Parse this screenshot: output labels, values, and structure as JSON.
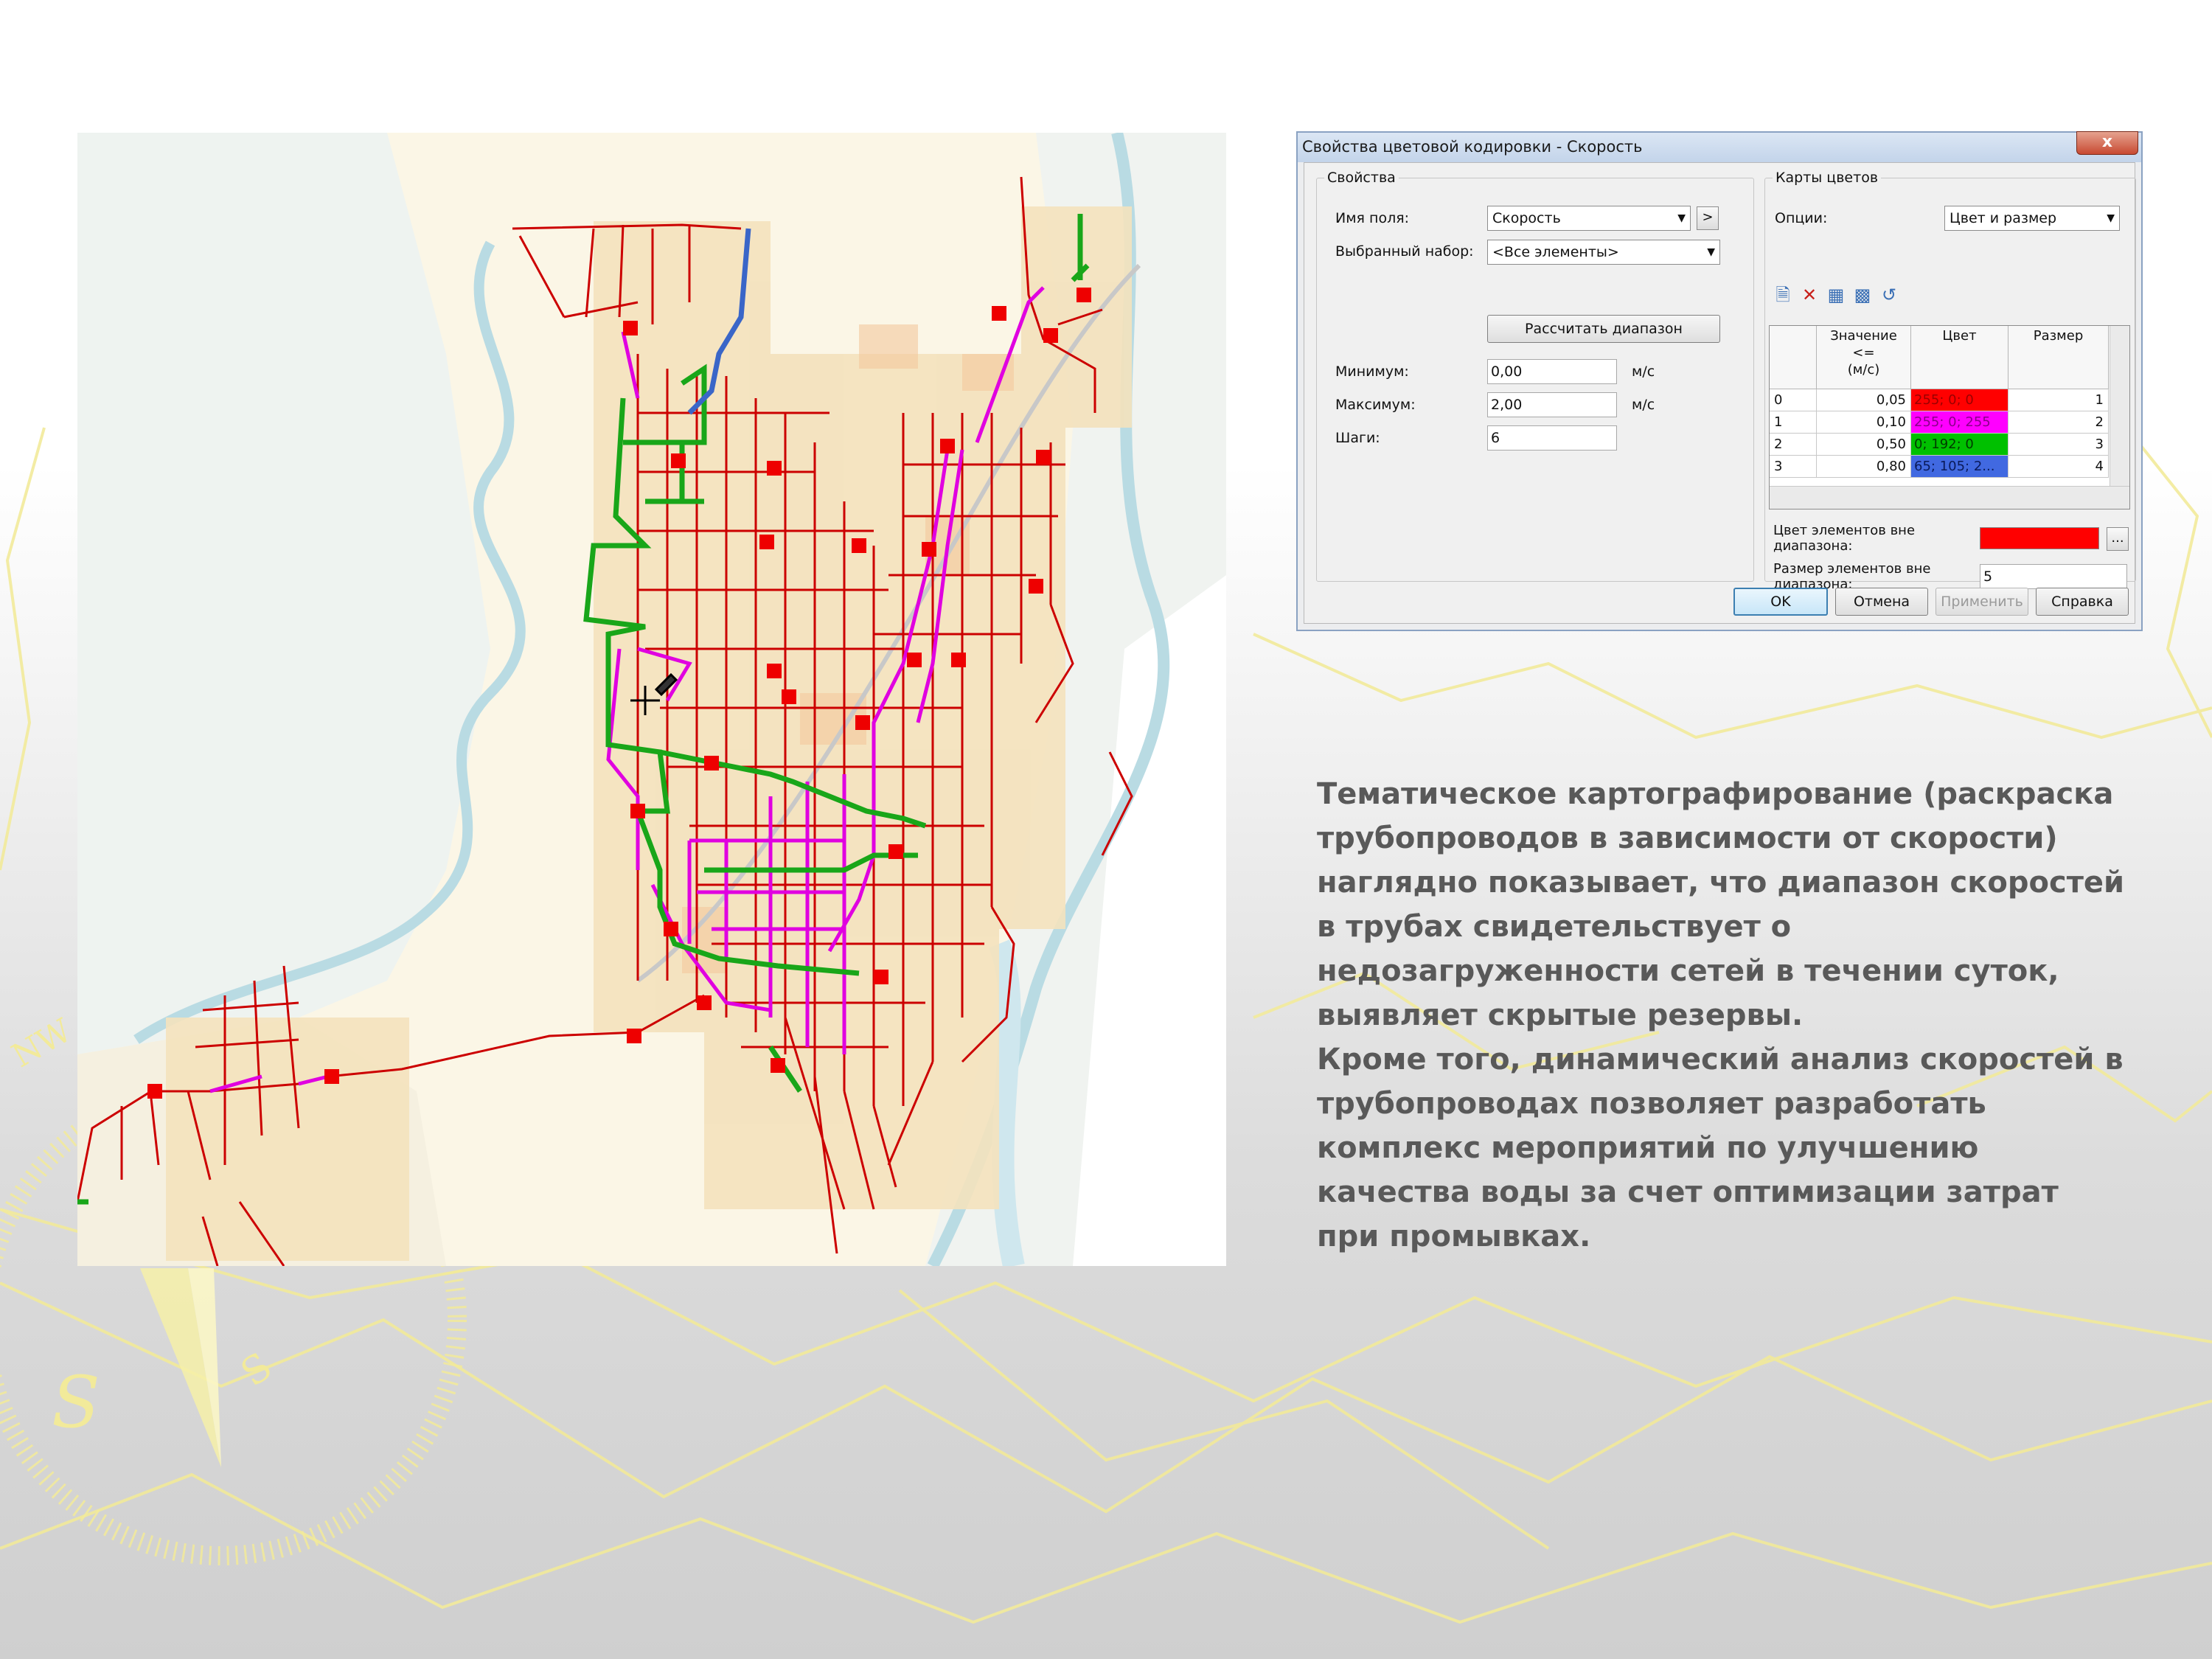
{
  "dialog": {
    "title": "Свойства цветовой кодировки - Скорость",
    "close_label": "x",
    "properties": {
      "group_label": "Свойства",
      "field_name_label": "Имя поля:",
      "field_name_value": "Скорость",
      "selection_label": "Выбранный набор:",
      "selection_value": "<Все элементы>",
      "calc_range_button": "Рассчитать диапазон",
      "minimum_label": "Минимум:",
      "minimum_value": "0,00",
      "minimum_unit": "м/с",
      "maximum_label": "Максимум:",
      "maximum_value": "2,00",
      "maximum_unit": "м/с",
      "steps_label": "Шаги:",
      "steps_value": "6"
    },
    "color_maps": {
      "group_label": "Карты цветов",
      "options_label": "Опции:",
      "options_value": "Цвет и размер",
      "columns": [
        "",
        "Значение\n<=\n(м/с)",
        "Цвет",
        "Размер"
      ],
      "rows": [
        {
          "index": "0",
          "value": "0,05",
          "color_text": "255; 0; 0",
          "color_hex": "#ff0000",
          "size": "1"
        },
        {
          "index": "1",
          "value": "0,10",
          "color_text": "255; 0; 255",
          "color_hex": "#ff00ff",
          "size": "2"
        },
        {
          "index": "2",
          "value": "0,50",
          "color_text": "0; 192; 0",
          "color_hex": "#00c000",
          "size": "3"
        },
        {
          "index": "3",
          "value": "0,80",
          "color_text": "65; 105; 2...",
          "color_hex": "#4169e1",
          "size": "4"
        }
      ],
      "out_of_range_color_label": "Цвет элементов вне диапазона:",
      "out_of_range_color_hex": "#ff0000",
      "out_of_range_size_label": "Размер элементов вне диапазона:",
      "out_of_range_size_value": "5",
      "ellipsis_button": "..."
    },
    "buttons": {
      "ok": "OK",
      "cancel": "Отмена",
      "apply": "Применить",
      "help": "Справка"
    }
  },
  "description": {
    "paragraph1": "Тематическое картографирование (раскраска трубопроводов в зависимости от скорости) наглядно показывает, что диапазон скоростей в трубах свидетельствует о недозагруженности сетей в течении суток, выявляет скрытые резервы.",
    "paragraph2": "Кроме того, динамический анализ скоростей в трубопроводах позволяет разработать комплекс мероприятий по улучшению качества воды за счет оптимизации затрат при промывках."
  },
  "background": {
    "compass_letter": "S",
    "compass_small_letters": "S",
    "compass_side_letters": "NW"
  },
  "colors": {
    "pipe_low": "#cc0000",
    "pipe_mid": "#e000e0",
    "pipe_high": "#19a619",
    "pipe_top": "#3a66c8",
    "node_marker": "#ee0000",
    "deco_lines": "#f2ea9a"
  }
}
